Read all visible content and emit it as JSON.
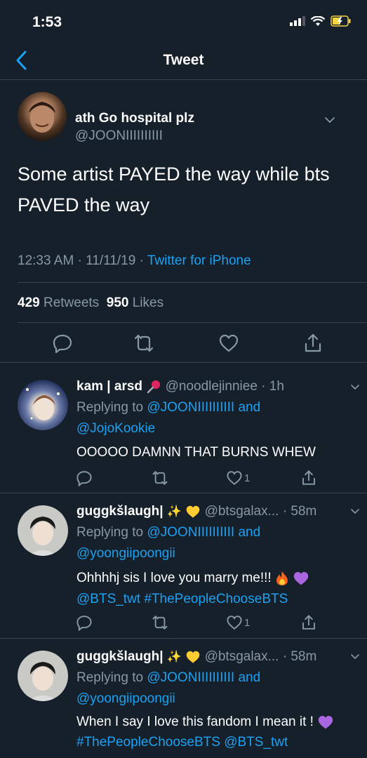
{
  "status": {
    "time": "1:53"
  },
  "nav": {
    "title": "Tweet"
  },
  "tweet": {
    "name": "ath Go hospital plz",
    "handle": "@JOONIIIIIIIIII",
    "text": "Some artist PAYED the way while bts PAVED the way",
    "time": "12:33 AM · 11/11/19 · ",
    "source": "Twitter for iPhone",
    "retweets": "429",
    "retweets_label": "Retweets",
    "likes": "950",
    "likes_label": "Likes"
  },
  "replies": [
    {
      "name": "kam | arsd",
      "handle": "@noodlejinniee · 1h",
      "replying_prefix": "Replying to ",
      "replying_to_1": "@JOONIIIIIIIIII",
      "replying_and": " and",
      "replying_to_2": "@JojoKookie",
      "text": "OOOOO DAMNN THAT BURNS WHEW",
      "like_count": "1"
    },
    {
      "name": "guggkšlaugh|",
      "handle": "@btsgalax... · 58m",
      "replying_prefix": "Replying to ",
      "replying_to_1": "@JOONIIIIIIIIII",
      "replying_and": " and",
      "replying_to_2": "@yoongiipoongii",
      "text": "Ohhhhj sis I love you marry me!!!",
      "hashtags": "@BTS_twt #ThePeopleChooseBTS",
      "like_count": "1"
    },
    {
      "name": "guggkšlaugh|",
      "handle": "@btsgalax... · 58m",
      "replying_prefix": "Replying to ",
      "replying_to_1": "@JOONIIIIIIIIII",
      "replying_and": " and",
      "replying_to_2": "@yoongiipoongii",
      "text": "When I say I love this fandom I mean it !",
      "hashtags": "#ThePeopleChooseBTS @BTS_twt"
    }
  ],
  "colors": {
    "background": "#15202b",
    "link": "#1da1f2",
    "muted": "#8899a6",
    "divider": "#38444d"
  }
}
